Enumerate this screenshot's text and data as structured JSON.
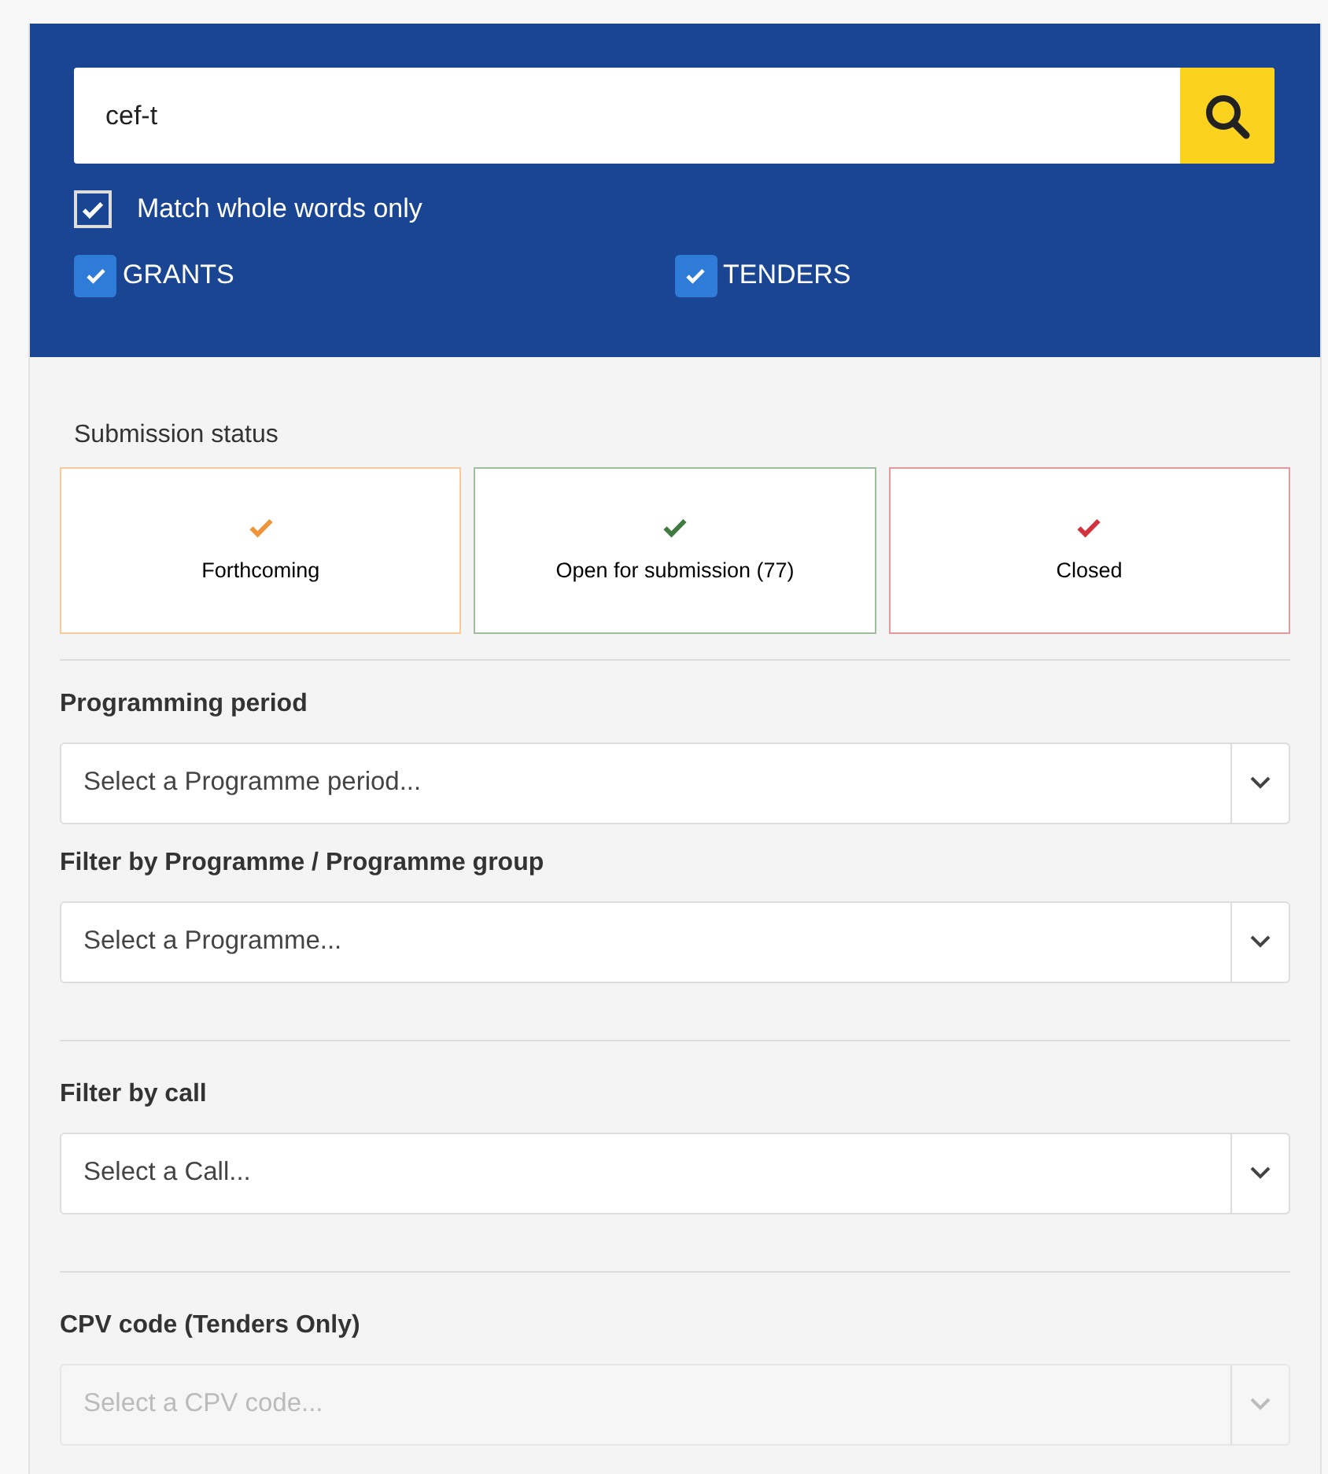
{
  "search": {
    "value": "cef-t"
  },
  "match_whole_words": {
    "label": "Match whole words only",
    "checked": true
  },
  "types": [
    {
      "label": "GRANTS",
      "checked": true
    },
    {
      "label": "TENDERS",
      "checked": true
    }
  ],
  "submission_status": {
    "title": "Submission status",
    "options": [
      {
        "label": "Forthcoming",
        "color": "#f0943a"
      },
      {
        "label": "Open for submission (77)",
        "color": "#3f7a3f"
      },
      {
        "label": "Closed",
        "color": "#d4323e"
      }
    ]
  },
  "filters": [
    {
      "label": "Programming period",
      "placeholder": "Select a Programme period...",
      "disabled": false,
      "divider_after": false
    },
    {
      "label": "Filter by Programme / Programme group",
      "placeholder": "Select a Programme...",
      "disabled": false,
      "divider_after": true
    },
    {
      "label": "Filter by call",
      "placeholder": "Select a Call...",
      "disabled": false,
      "divider_after": true
    },
    {
      "label": "CPV code (Tenders Only)",
      "placeholder": "Select a CPV code...",
      "disabled": true,
      "divider_after": false
    }
  ]
}
